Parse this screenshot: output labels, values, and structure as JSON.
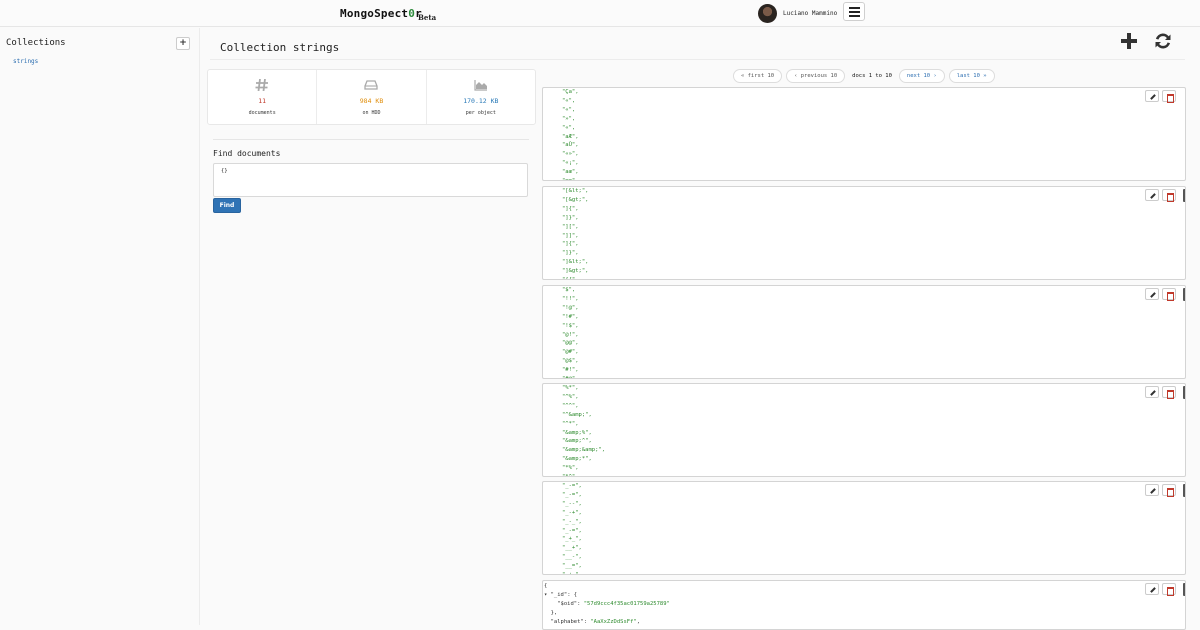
{
  "header": {
    "logo_main": "MongoSpect",
    "logo_zero": "0",
    "logo_end": "r",
    "logo_beta": "Beta",
    "user_name": "Luciano Mammino"
  },
  "sidebar": {
    "title": "Collections",
    "add_label": "+",
    "items": [
      {
        "label": "strings"
      }
    ]
  },
  "main": {
    "title": "Collection strings",
    "stats": [
      {
        "icon": "hash-icon",
        "value": "11",
        "label": "documents",
        "color": "#c0392b"
      },
      {
        "icon": "hdd-icon",
        "value": "984 KB",
        "label": "on HDD",
        "color": "#e08e0b"
      },
      {
        "icon": "area-chart-icon",
        "value": "170.12 KB",
        "label": "per object",
        "color": "#2a7ab8"
      }
    ],
    "find": {
      "title": "Find documents",
      "query": "{}",
      "button": "Find"
    },
    "pager": {
      "first": "« first 10",
      "previous": "‹ previous 10",
      "info": "docs 1 to 10",
      "next": "next 10 ›",
      "last": "last 10 »"
    },
    "documents": [
      {
        "lines": [
          "\"Ça\",",
          "\"«\",",
          "\"«\",",
          "\"»\",",
          "\"«\",",
          "\"aÆ\",",
          "\"aÛ\",",
          "\"«»\",",
          "\"«¡\",",
          "\"aæ\",",
          "\"¬¬\","
        ]
      },
      {
        "lines": [
          "\"[&lt;\",",
          "\"[&gt;\",",
          "\"]{\",",
          "\"]}\",",
          "\"][\",",
          "\"]]\",",
          "\"]{\",",
          "\"]}\",",
          "\"]&lt;\",",
          "\"]&gt;\",",
          "\"{{\","
        ]
      },
      {
        "lines": [
          "\"$\",",
          "\"!!\",",
          "\"!@\",",
          "\"!#\",",
          "\"!$\",",
          "\"@!\",",
          "\"@@\",",
          "\"@#\",",
          "\"@$\",",
          "\"#!\",",
          "\"#@\","
        ]
      },
      {
        "lines": [
          "\"%*\",",
          "\"^%\",",
          "\"^^\",",
          "\"^&amp;\",",
          "\"^*\",",
          "\"&amp;%\",",
          "\"&amp;^\",",
          "\"&amp;&amp;\",",
          "\"&amp;*\",",
          "\"*%\",",
          "\"*^\","
        ]
      },
      {
        "lines": [
          "\"_-=\",",
          "\"_-=\",",
          "\"_--\",",
          "\"_-+\",",
          "\"_-_\",",
          "\"_-=\",",
          "\"_+_\",",
          "\"__+\",",
          "\"__-\",",
          "\"__=\",",
          "\"_+_\","
        ]
      }
    ],
    "last_document": {
      "open": "{",
      "id_key": "\"_id\"",
      "oid_key": "\"$oid\"",
      "oid_value": "\"57d9ccc4f35ac01759a25789\"",
      "close_id": "},",
      "alphabet_key": "\"alphabet\"",
      "alphabet_value": "\"AaXxZzDdSsFf\""
    }
  }
}
